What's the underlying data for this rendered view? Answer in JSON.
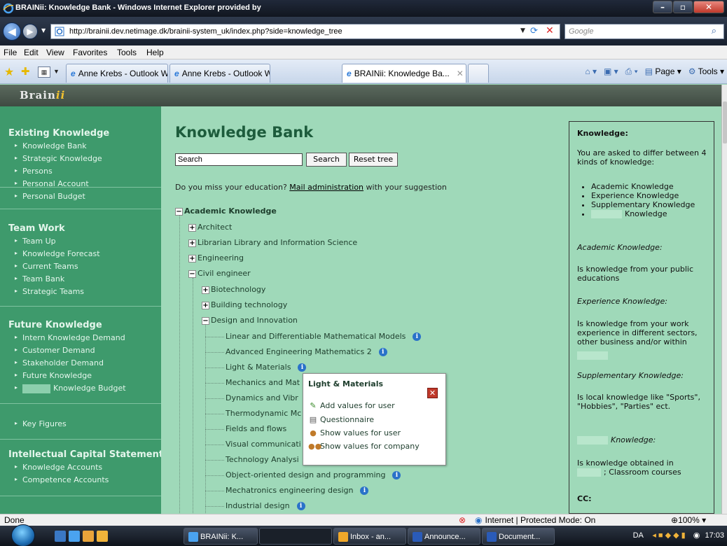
{
  "browser": {
    "window_title": "BRAINii: Knowledge Bank - Windows Internet Explorer provided by",
    "url": "http://brainii.dev.netimage.dk/brainii-system_uk/index.php?side=knowledge_tree",
    "search_placeholder": "Google",
    "menu": [
      "File",
      "Edit",
      "View",
      "Favorites",
      "Tools",
      "Help"
    ],
    "tabs": [
      {
        "label": "Anne Krebs - Outlook Web..."
      },
      {
        "label": "Anne Krebs - Outlook Web..."
      },
      {
        "label": "BRAINii: Knowledge Ba..."
      }
    ],
    "tools": {
      "page": "Page",
      "tools": "Tools"
    },
    "status": {
      "done": "Done",
      "zone": "Internet | Protected Mode: On",
      "zoom": "100%"
    }
  },
  "brand": {
    "name": "Brain",
    "suffix": "ii"
  },
  "sidebar": {
    "sections": [
      {
        "title": "Existing Knowledge",
        "items": [
          "Knowledge Bank",
          "Strategic Knowledge",
          "Persons",
          "Personal Account",
          "Personal Budget"
        ]
      },
      {
        "title": "Team Work",
        "items": [
          "Team Up",
          "Knowledge Forecast",
          "Current Teams",
          "Team Bank",
          "Strategic Teams"
        ]
      },
      {
        "title": "Future Knowledge",
        "items": [
          "Intern Knowledge Demand",
          "Customer Demand",
          "Stakeholder Demand",
          "Future Knowledge",
          "Knowledge Budget"
        ]
      },
      {
        "title": "",
        "items": [
          "Key Figures"
        ]
      },
      {
        "title": "Intellectual Capital Statement",
        "items": [
          "Knowledge Accounts",
          "Competence Accounts"
        ]
      }
    ]
  },
  "main": {
    "title": "Knowledge Bank",
    "search_value": "Search",
    "search_button": "Search",
    "reset_button": "Reset tree",
    "mail_prefix": "Do you miss your education? ",
    "mail_link": "Mail administration",
    "mail_suffix": " with your suggestion",
    "tree": {
      "root": "Academic Knowledge",
      "level1": [
        "Architect",
        "Librarian Library and Information Science",
        "Engineering",
        "Civil engineer"
      ],
      "level2": [
        "Biotechnology",
        "Building technology",
        "Design and Innovation"
      ],
      "level3": [
        "Linear and Differentiable Mathematical Models",
        "Advanced Engineering Mathematics 2",
        "Light & Materials",
        "Mechanics and Mat",
        "Dynamics and Vibr",
        "Thermodynamic Mc",
        "Fields and flows",
        "Visual communicati",
        "Technology Analysi",
        "Object-oriented design and programming",
        "Mechatronics engineering design",
        "Industrial design"
      ]
    }
  },
  "popup": {
    "title": "Light & Materials",
    "items": [
      "Add values for user",
      "Questionnaire",
      "Show values for user",
      "Show values for company"
    ]
  },
  "right_panel": {
    "heading": "Knowledge:",
    "intro": "You are asked to differ between 4 kinds of knowledge:",
    "list": [
      "Academic Knowledge",
      "Experience Knowledge",
      "Supplementary Knowledge",
      "Knowledge"
    ],
    "academic_title": "Academic Knowledge:",
    "academic_text": "Is knowledge from your public educations",
    "experience_title": "Experience Knowledge:",
    "experience_text": "Is knowledge from your work experience in different sectors, other business and/or within",
    "supplementary_title": "Supplementary Knowledge:",
    "supplementary_text": "Is local knowledge like \"Sports\", \"Hobbies\", \"Parties\" ect.",
    "fourth_title": "Knowledge:",
    "fourth_text_1": "Is knowledge obtained in",
    "fourth_text_2": "; Classroom courses",
    "cc": "CC:"
  },
  "taskbar": {
    "buttons": [
      "BRAINii: K...",
      "Inbox - an...",
      "Announce...",
      "Document..."
    ],
    "lang": "DA",
    "time": "17:03"
  }
}
